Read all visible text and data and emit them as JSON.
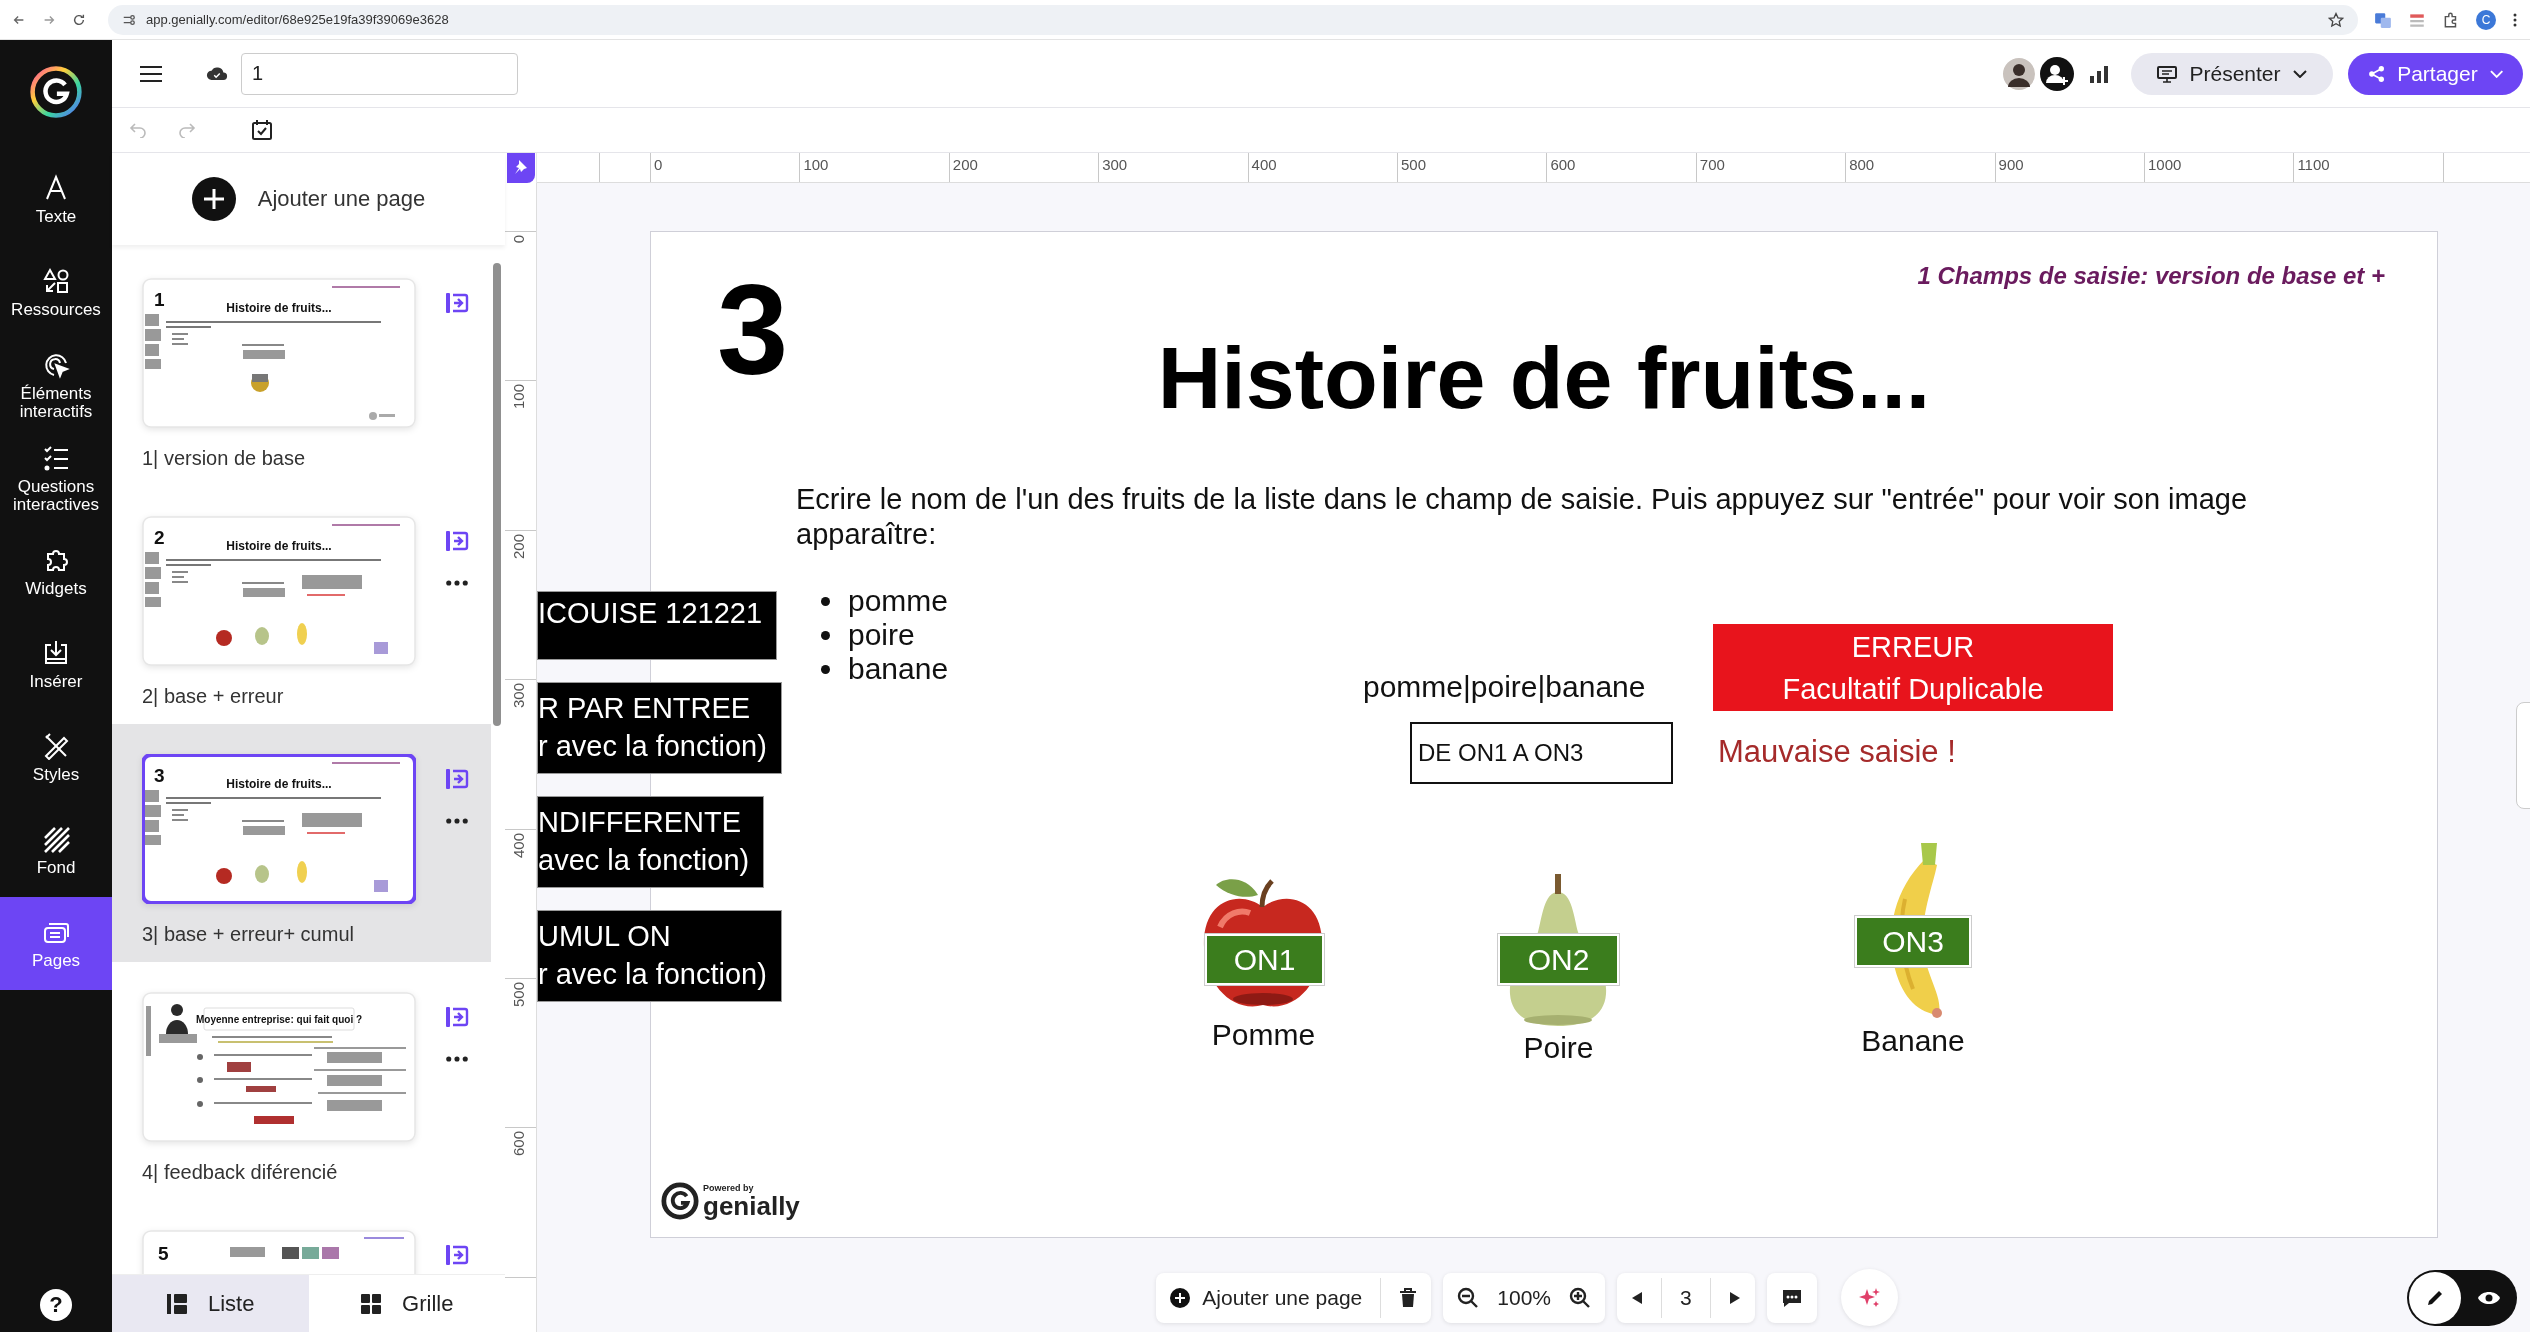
{
  "browser": {
    "url": "app.genially.com/editor/68e925e19fa39f39069e3628",
    "profile": "C"
  },
  "rail": {
    "items": [
      {
        "label": "Texte",
        "kind": "text",
        "selected": false
      },
      {
        "label": "Ressources",
        "kind": "shapes",
        "selected": false
      },
      {
        "label": "Éléments interactifs",
        "kind": "interactive",
        "selected": false
      },
      {
        "label": "Questions interactives",
        "kind": "questions",
        "selected": false
      },
      {
        "label": "Widgets",
        "kind": "widgets",
        "selected": false
      },
      {
        "label": "Insérer",
        "kind": "insert",
        "selected": false
      },
      {
        "label": "Styles",
        "kind": "styles",
        "selected": false
      },
      {
        "label": "Fond",
        "kind": "background",
        "selected": false
      },
      {
        "label": "Pages",
        "kind": "pages",
        "selected": true
      }
    ],
    "help": "?"
  },
  "topbar": {
    "project_name": "1",
    "present": "Présenter",
    "share": "Partager"
  },
  "pages_panel": {
    "add_page": "Ajouter une page",
    "pages": [
      {
        "number": "1",
        "title": "Histoire de fruits...",
        "label": "1| version de base",
        "kind": "one-fruit",
        "selected": false,
        "more_button": false
      },
      {
        "number": "2",
        "title": "Histoire de fruits...",
        "label": "2| base + erreur",
        "kind": "three-fruits",
        "selected": false,
        "more_button": true
      },
      {
        "number": "3",
        "title": "Histoire de fruits...",
        "label": "3| base + erreur+ cumul",
        "kind": "three-fruits",
        "selected": true,
        "more_button": true
      },
      {
        "title": "Moyenne entreprise: qui fait quoi ?",
        "label": "4| feedback diférencié",
        "kind": "quiz",
        "selected": false,
        "more_button": true
      },
      {
        "number": "5",
        "kind": "icons-row",
        "selected": false,
        "more_button": false
      }
    ],
    "view_tabs": [
      {
        "label": "Liste",
        "kind": "list",
        "selected": true
      },
      {
        "label": "Grille",
        "kind": "grid",
        "selected": false
      }
    ]
  },
  "rulers": {
    "horizontal": [
      "0",
      "100",
      "200",
      "300",
      "400",
      "500",
      "600",
      "700",
      "800",
      "900",
      "1000",
      "1100"
    ],
    "vertical": [
      "0",
      "100",
      "200",
      "300",
      "400",
      "500",
      "600"
    ]
  },
  "code_blocks": [
    {
      "lines": [
        "ICOUISE 121221"
      ]
    },
    {
      "lines": [
        "R PAR ENTREE",
        "r avec la fonction)"
      ]
    },
    {
      "lines": [
        "NDIFFERENTE",
        "avec la fonction)"
      ]
    },
    {
      "lines": [
        "UMUL ON",
        "r avec la fonction)"
      ]
    }
  ],
  "slide": {
    "number": "3",
    "subtitle": "1 Champs de saisie: version de base et +",
    "title": "Histoire de fruits...",
    "instructions": "Ecrire le nom de l'un des fruits de la liste dans le champ de saisie. Puis appuyez sur \"entrée\" pour voir son image apparaître:",
    "fruit_list": [
      "pomme",
      "poire",
      "banane"
    ],
    "answer_hint": "pomme|poire|banane",
    "input_value": "DE ON1 A ON3",
    "error_box": [
      "ERREUR",
      "Facultatif Duplicable"
    ],
    "error_message": "Mauvaise saisie !",
    "fruits": [
      {
        "kind": "apple",
        "tag": "ON1",
        "name": "Pomme"
      },
      {
        "kind": "pear",
        "tag": "ON2",
        "name": "Poire"
      },
      {
        "kind": "banana",
        "tag": "ON3",
        "name": "Banane"
      }
    ],
    "powered_by": "Powered by",
    "brand": "genially"
  },
  "bottom_toolbar": {
    "add_page": "Ajouter une page",
    "zoom": "100%",
    "page": "3"
  }
}
